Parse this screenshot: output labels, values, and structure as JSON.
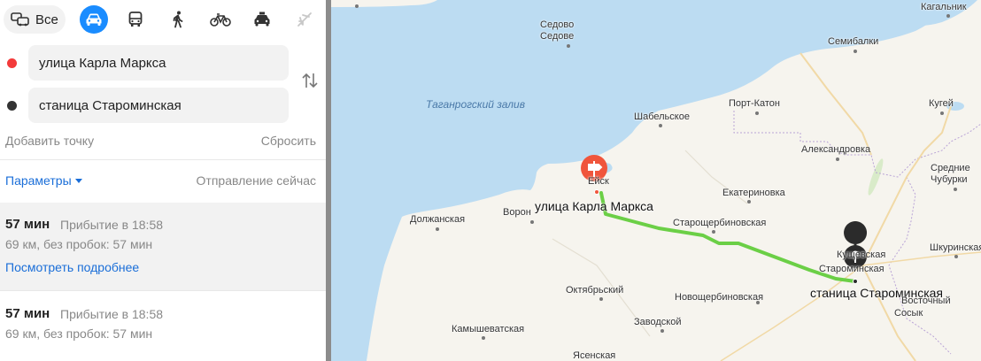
{
  "modes": {
    "all_label": "Все",
    "items": [
      "car-icon",
      "bus-icon",
      "pedestrian-icon",
      "bicycle-icon",
      "taxi-icon",
      "plane-icon"
    ],
    "active": "car-icon"
  },
  "route_form": {
    "from": "улица Карла Маркса",
    "to": "станица Староминская",
    "add_point": "Добавить точку",
    "reset": "Сбросить",
    "params": "Параметры",
    "departure": "Отправление сейчас",
    "from_color": "#f33a3a",
    "to_color": "#333333"
  },
  "routes": [
    {
      "time": "57 мин",
      "arrival": "Прибытие в 18:58",
      "details": "69 км, без пробок: 57 мин",
      "more": "Посмотреть подробнее"
    },
    {
      "time": "57 мин",
      "arrival": "Прибытие в 18:58",
      "details": "69 км, без пробок: 57 мин"
    }
  ],
  "map": {
    "sea_label": "Таганрогский залив",
    "start_label": "улица Карла Маркса",
    "end_label": "станица Староминская",
    "places": {
      "sedovo": "Седово",
      "sedove": "Седове",
      "kagalnik": "Кагальник",
      "semibalki": "Семибалки",
      "shabelskoe": "Шабельское",
      "port_katon": "Порт-Катон",
      "kugei": "Кугей",
      "aleksandrovka": "Александровка",
      "srednie": "Средние",
      "chuburki": "Чубурки",
      "eysk": "Ейск",
      "ekaterinovka": "Екатериновка",
      "dolzhanskaya": "Должанская",
      "voron": "Ворон",
      "starosherbinovskaya": "Старощербиновская",
      "kuzh": "Кущевская",
      "starominskaya": "Староминская",
      "shkurinskaya": "Шкуринская",
      "oktyabrsky": "Октябрьский",
      "novoshcherbinovskaya": "Новощербиновская",
      "vostochny": "Восточный",
      "sosyk": "Сосык",
      "zavodskoy": "Заводской",
      "kamyshevatskaya": "Камышеватская",
      "yasenskaya": "Ясенская"
    },
    "colors": {
      "sea": "#bcdcf2",
      "land": "#f6f4ee",
      "route": "#6bcf46",
      "start_pin": "#f0553c",
      "end_pin": "#2b2b2b"
    }
  }
}
